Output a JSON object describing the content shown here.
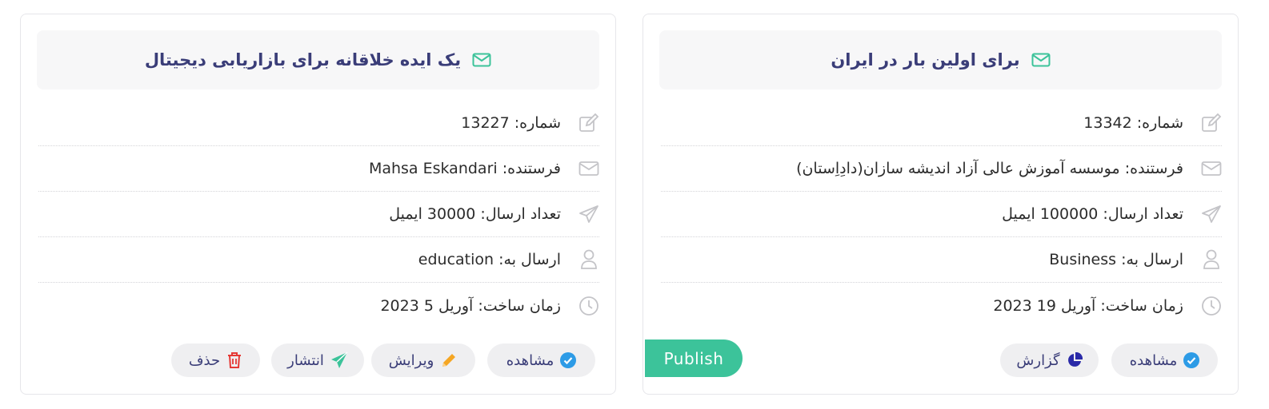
{
  "cards": [
    {
      "title": "برای اولین بار در ایران",
      "rows": [
        {
          "icon": "edit-icon",
          "text": "شماره: 13342"
        },
        {
          "icon": "envelope-icon",
          "text": "فرستنده: موسسه آموزش عالی آزاد اندیشه سازان(دادِاِستان)"
        },
        {
          "icon": "paper-plane-icon",
          "text": "تعداد ارسال: 100000 ایمیل"
        },
        {
          "icon": "user-icon",
          "text": "ارسال به: Business"
        },
        {
          "icon": "clock-icon",
          "text": "زمان ساخت: آوریل 19 2023"
        }
      ],
      "actions": [
        {
          "icon": "check-circle-icon",
          "label": "مشاهده",
          "color": "#2d9be6"
        },
        {
          "icon": "pie-chart-icon",
          "label": "گزارش",
          "color": "#2a2aa8"
        }
      ],
      "publish_label": "Publish"
    },
    {
      "title": "یک ایده خلاقانه برای بازاریابی دیجیتال",
      "rows": [
        {
          "icon": "edit-icon",
          "text": "شماره: 13227"
        },
        {
          "icon": "envelope-icon",
          "text": "فرستنده: Mahsa Eskandari"
        },
        {
          "icon": "paper-plane-icon",
          "text": "تعداد ارسال: 30000 ایمیل"
        },
        {
          "icon": "user-icon",
          "text": "ارسال به: education"
        },
        {
          "icon": "clock-icon",
          "text": "زمان ساخت: آوریل 5 2023"
        }
      ],
      "actions": [
        {
          "icon": "check-circle-icon",
          "label": "مشاهده",
          "color": "#2d9be6"
        },
        {
          "icon": "pencil-icon",
          "label": "ویرایش",
          "color": "#f5a623"
        },
        {
          "icon": "paper-plane-icon",
          "label": "انتشار",
          "color": "#3cc39a"
        },
        {
          "icon": "trash-icon",
          "label": "حذف",
          "color": "#e53935"
        }
      ]
    }
  ],
  "colors": {
    "title": "#3a3d78",
    "header_icon": "#3cc39a",
    "row_icon": "#c4c4c8",
    "publish": "#3cc39a"
  }
}
